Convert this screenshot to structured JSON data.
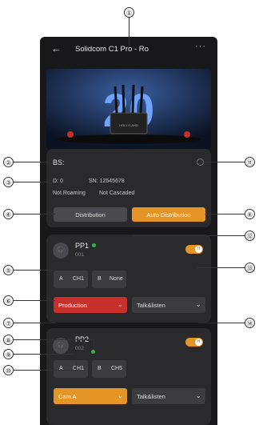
{
  "callouts": [
    "①",
    "②",
    "③",
    "④",
    "⑤",
    "⑥",
    "⑦",
    "⑧",
    "⑨",
    "⑩",
    "⑪",
    "⑫",
    "⑬",
    "⑭"
  ],
  "header": {
    "back_icon": "←",
    "title": "Solidcom C1 Pro - Ro",
    "more_icon": "···"
  },
  "hero": {
    "number": "20",
    "brand_caption": "HOLLYLAND"
  },
  "base_station": {
    "label": "BS:",
    "id_text": "D: 0",
    "sn_text": "SN: 12545678",
    "roaming": "Not Roaming",
    "cascade": "Not Cascaded",
    "distribution_btn": "Distribution",
    "auto_distribution_btn": "Auto Distribution"
  },
  "pp1": {
    "name": "PP1",
    "id": "001",
    "toggle": "H",
    "ch_a_label": "A",
    "ch_a_value": "CH1",
    "ch_b_label": "B",
    "ch_b_value": "None",
    "group": "Production",
    "mode": "Talk&listen"
  },
  "pp2": {
    "name": "PP2",
    "id": "002",
    "toggle": "H",
    "ch_a_label": "A",
    "ch_a_value": "CH1",
    "ch_b_label": "B",
    "ch_b_value": "CH5",
    "group": "Cam A",
    "mode": "Talk&listen"
  },
  "colors": {
    "accent": "#e59526",
    "red": "#c8302c",
    "online": "#2fb34a",
    "background": "#18181a"
  }
}
